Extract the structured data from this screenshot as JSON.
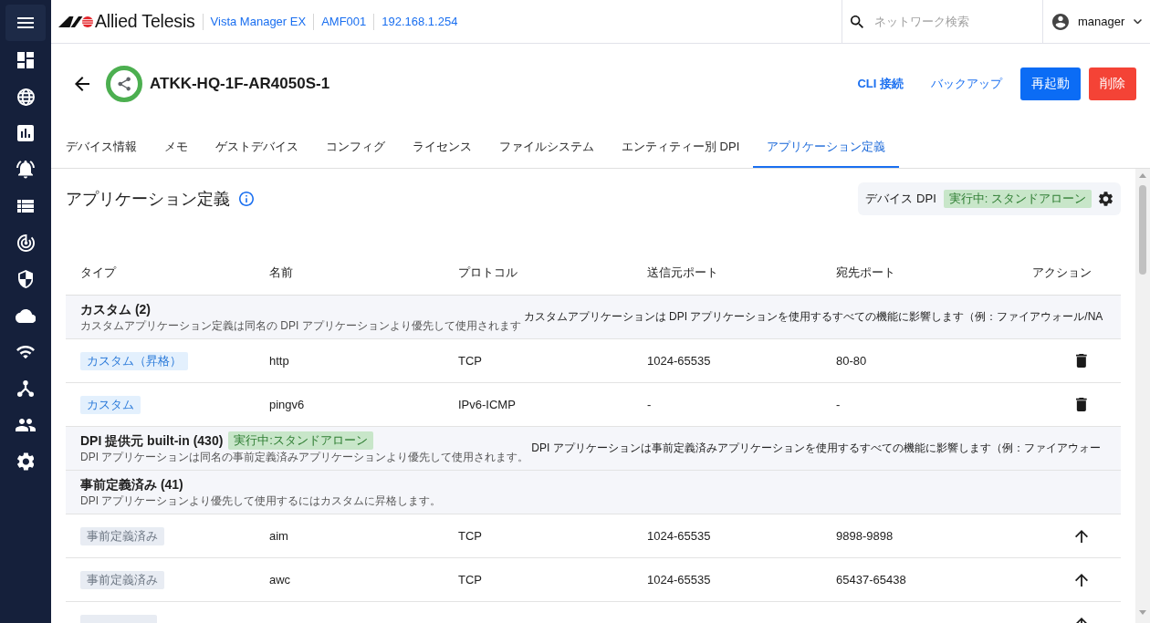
{
  "topbar": {
    "brand": "Allied Telesis",
    "breadcrumbs": [
      "Vista Manager EX",
      "AMF001",
      "192.168.1.254"
    ],
    "search": {
      "placeholder": "ネットワーク検索"
    },
    "user": "manager"
  },
  "device": {
    "name": "ATKK-HQ-1F-AR4050S-1",
    "actions": [
      {
        "label": "CLI 接続",
        "kind": "link"
      },
      {
        "label": "バックアップ",
        "kind": "link"
      },
      {
        "label": "再起動",
        "kind": "primary"
      },
      {
        "label": "削除",
        "kind": "danger"
      }
    ]
  },
  "tabs": [
    {
      "label": "デバイス情報",
      "selected": false
    },
    {
      "label": "メモ",
      "selected": false
    },
    {
      "label": "ゲストデバイス",
      "selected": false
    },
    {
      "label": "コンフィグ",
      "selected": false
    },
    {
      "label": "ライセンス",
      "selected": false
    },
    {
      "label": "ファイルシステム",
      "selected": false
    },
    {
      "label": "エンティティー別 DPI",
      "selected": false
    },
    {
      "label": "アプリケーション定義",
      "selected": true
    }
  ],
  "section": {
    "title": "アプリケーション定義",
    "dpi": {
      "label": "デバイス DPI",
      "status": "実行中: スタンドアローン"
    }
  },
  "table": {
    "columns": [
      "タイプ",
      "名前",
      "プロトコル",
      "送信元ポート",
      "宛先ポート",
      "アクション"
    ],
    "rows": [
      {
        "kind": "group",
        "title": "カスタム (2)",
        "description": "カスタムアプリケーション定義は同名の DPI アプリケーションより優先して使用されます",
        "note": "カスタムアプリケーションは DPI アプリケーションを使用するすべての機能に影響します（例：ファイアウォール/NA"
      },
      {
        "kind": "app",
        "type": {
          "label": "カスタム（昇格）",
          "kind": "custom"
        },
        "name": "http",
        "protocol": "TCP",
        "source_port": "1024-65535",
        "destination_port": "80-80",
        "action": {
          "kind": "delete"
        }
      },
      {
        "kind": "app",
        "type": {
          "label": "カスタム",
          "kind": "custom"
        },
        "name": "pingv6",
        "protocol": "IPv6-ICMP",
        "source_port": "-",
        "destination_port": "-",
        "action": {
          "kind": "delete"
        }
      },
      {
        "kind": "group",
        "title": "DPI 提供元 built-in (430)",
        "badge": "実行中:スタンドアローン",
        "description": "DPI アプリケーションは同名の事前定義済みアプリケーションより優先して使用されます。",
        "note": "DPI アプリケーションは事前定義済みアプリケーションを使用するすべての機能に影響します（例：ファイアウォー"
      },
      {
        "kind": "group",
        "title": "事前定義済み (41)",
        "description": "DPI アプリケーションより優先して使用するにはカスタムに昇格します。"
      },
      {
        "kind": "app",
        "type": {
          "label": "事前定義済み",
          "kind": "predefined"
        },
        "name": "aim",
        "protocol": "TCP",
        "source_port": "1024-65535",
        "destination_port": "9898-9898",
        "action": {
          "kind": "promote"
        }
      },
      {
        "kind": "app",
        "type": {
          "label": "事前定義済み",
          "kind": "predefined"
        },
        "name": "awc",
        "protocol": "TCP",
        "source_port": "1024-65535",
        "destination_port": "65437-65438",
        "action": {
          "kind": "promote"
        }
      },
      {
        "kind": "app",
        "type": {
          "kind": "predefined"
        },
        "action": {
          "kind": "promote"
        }
      }
    ]
  }
}
